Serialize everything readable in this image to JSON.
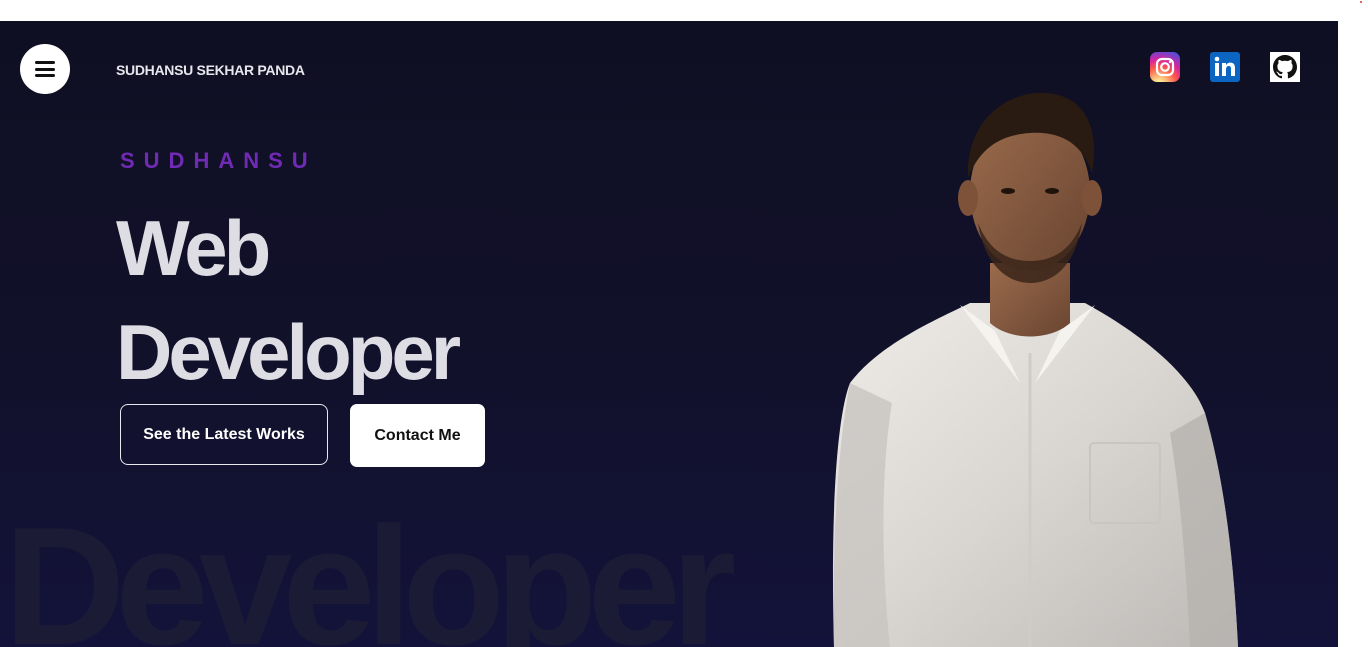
{
  "header": {
    "site_name": "SUDHANSU SEKHAR PANDA",
    "menu_icon": "hamburger-menu-icon",
    "socials": [
      {
        "name": "instagram",
        "icon": "instagram-icon",
        "color": "#d6249f"
      },
      {
        "name": "linkedin",
        "icon": "linkedin-icon",
        "color": "#0a66c2"
      },
      {
        "name": "github",
        "icon": "github-icon",
        "color": "#000000"
      }
    ]
  },
  "hero": {
    "eyebrow": "SUDHANSU",
    "headline_line1": "Web",
    "headline_line2": "Developer",
    "background_word": "Developer",
    "buttons": {
      "works_label": "See the Latest Works",
      "contact_label": "Contact Me"
    },
    "portrait": "person-portrait"
  },
  "colors": {
    "background": "#0f0f23",
    "accent": "#6f2bb3",
    "headline": "#dedde4",
    "button_light": "#ffffff"
  }
}
